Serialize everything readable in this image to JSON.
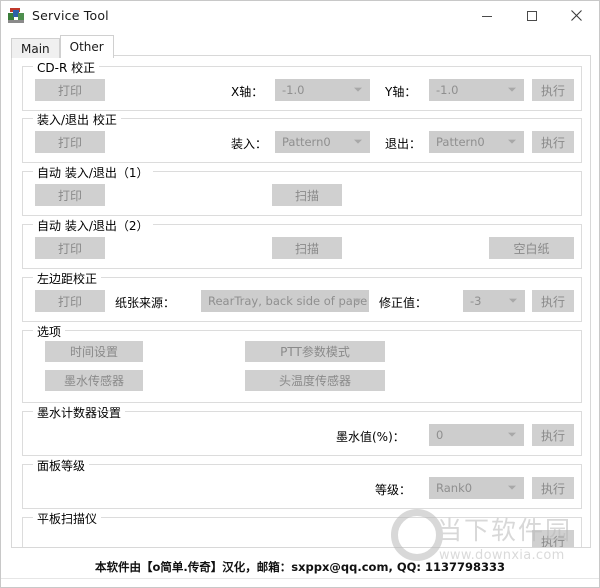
{
  "window": {
    "title": "Service Tool",
    "icon": "printer-tool-icon",
    "minimize": "—",
    "maximize": "□",
    "close": "✕"
  },
  "tabs": [
    {
      "label": "Main",
      "active": false
    },
    {
      "label": "Other",
      "active": true
    }
  ],
  "groups": {
    "cdr": {
      "title": "CD-R 校正",
      "print_button": "打印",
      "x_label": "X轴：",
      "x_value": "-1.0",
      "y_label": "Y轴：",
      "y_value": "-1.0",
      "exec_button": "执行"
    },
    "load_eject": {
      "title": "装入/退出 校正",
      "print_button": "打印",
      "load_label": "装入：",
      "load_value": "Pattern0",
      "eject_label": "退出：",
      "eject_value": "Pattern0",
      "exec_button": "执行"
    },
    "auto1": {
      "title": "自动 装入/退出（1）",
      "print_button": "打印",
      "scan_button": "扫描"
    },
    "auto2": {
      "title": "自动 装入/退出（2）",
      "print_button": "打印",
      "scan_button": "扫描",
      "blank_button": "空白纸"
    },
    "left_margin": {
      "title": "左边距校正",
      "print_button": "打印",
      "source_label": "纸张来源：",
      "source_value": "RearTray, back side of paper",
      "correction_label": "修正值：",
      "correction_value": "-3",
      "exec_button": "执行"
    },
    "options": {
      "title": "选项",
      "time_button": "时间设置",
      "ptt_button": "PTT参数模式",
      "ink_sensor_button": "墨水传感器",
      "head_temp_button": "头温度传感器"
    },
    "ink_counter": {
      "title": "墨水计数器设置",
      "ink_label": "墨水值(%)：",
      "ink_value": "0",
      "exec_button": "执行"
    },
    "panel_rank": {
      "title": "面板等级",
      "rank_label": "等级：",
      "rank_value": "Rank0",
      "exec_button": "执行"
    },
    "flatbed": {
      "title": "平板扫描仪",
      "exec_button": "执行"
    }
  },
  "footer": {
    "text": "本软件由【o简单.传奇】汉化，邮箱：sxppx@qq.com, QQ: 1137798333"
  },
  "watermark": {
    "logo": "o-logo",
    "brand": "当下软件园",
    "url": "www.downxia.com"
  },
  "colors": {
    "window_bg": "#ffffff",
    "group_border": "#dcdcdc",
    "control_disabled": "#d0d0d0",
    "combo_disabled": "#cdcdcd",
    "text": "#000000",
    "disabled_text": "#8a8a8a"
  }
}
